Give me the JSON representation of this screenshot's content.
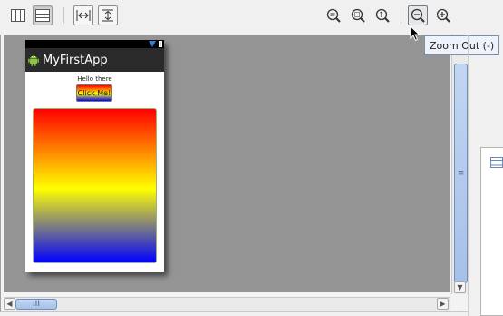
{
  "toolbar": {
    "buttons": [
      {
        "name": "split-columns-icon"
      },
      {
        "name": "split-rows-icon"
      },
      {
        "name": "fit-width-icon"
      },
      {
        "name": "fit-height-icon"
      },
      {
        "name": "zoom-reset-icon"
      },
      {
        "name": "zoom-fit-icon"
      },
      {
        "name": "zoom-actual-icon"
      },
      {
        "name": "zoom-out-icon"
      },
      {
        "name": "zoom-in-icon"
      }
    ]
  },
  "tooltip": {
    "text": "Zoom Out (-)"
  },
  "device": {
    "app_title": "MyFirstApp",
    "hello_text": "Hello there",
    "button_label": "Click Me!",
    "gradient_colors": [
      "#ff0000",
      "#ffff00",
      "#0000ff"
    ]
  },
  "scroll": {
    "vertical_grip": "≡",
    "horizontal_grip": "III"
  },
  "colors": {
    "canvas": "#959595",
    "scroll_thumb": "#a6c0e8"
  }
}
